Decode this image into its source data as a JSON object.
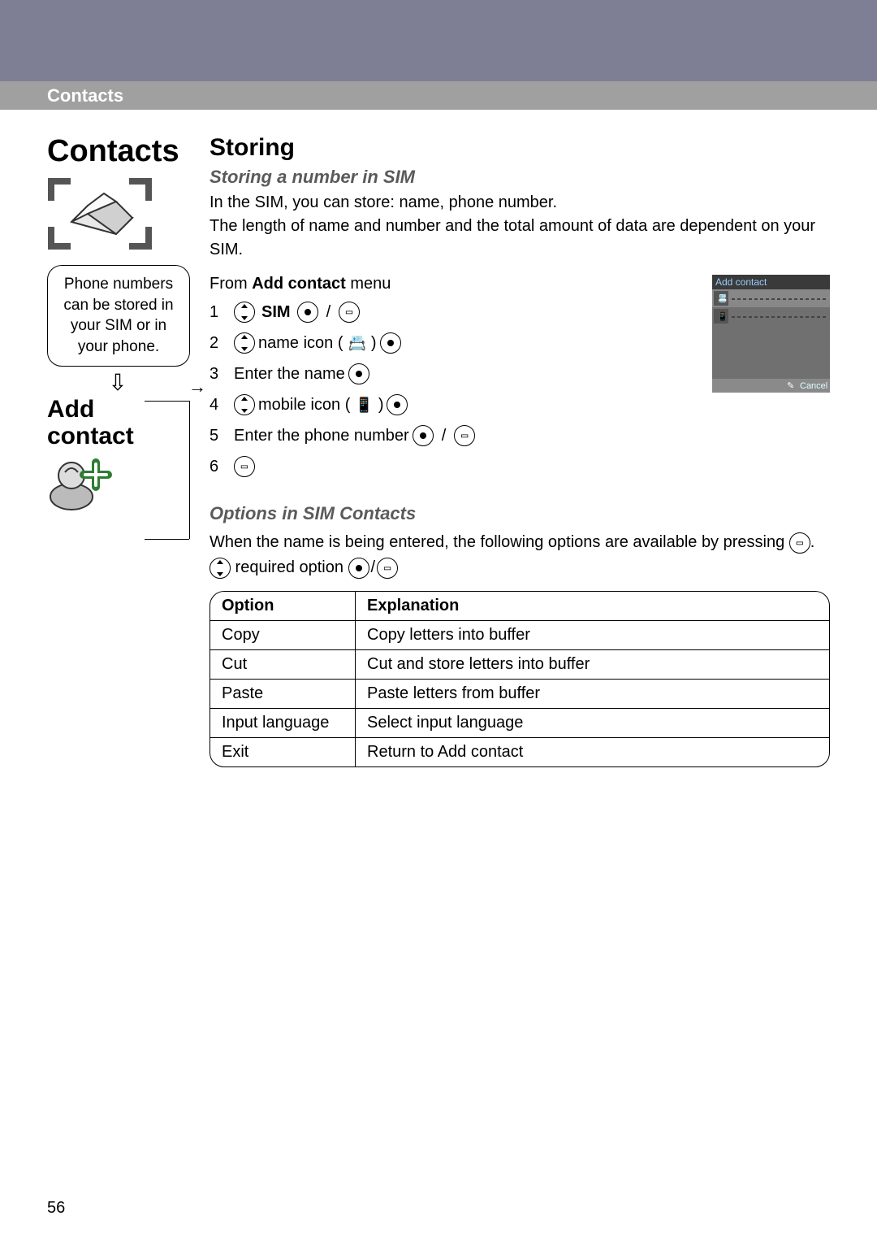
{
  "header": {
    "breadcrumb": "Contacts"
  },
  "left": {
    "title": "Contacts",
    "note": "Phone numbers can be stored in your SIM or in your phone.",
    "add_title_line1": "Add",
    "add_title_line2": "contact"
  },
  "main": {
    "h2": "Storing",
    "h3_sim": "Storing a number in SIM",
    "sim_p1": "In the SIM, you can store: name, phone number.",
    "sim_p2": "The length of name and number and the total amount of data are dependent on your SIM.",
    "from_prefix": "From ",
    "from_bold": "Add contact",
    "from_suffix": " menu",
    "steps": [
      {
        "n": "1",
        "parts": [
          "nav",
          " ",
          {
            "bold": "SIM"
          },
          " ",
          "dot",
          " ",
          "/",
          " ",
          "menu"
        ]
      },
      {
        "n": "2",
        "parts": [
          "nav",
          " name icon (",
          "name-glyph",
          ") ",
          "dot"
        ]
      },
      {
        "n": "3",
        "parts": [
          "Enter the name ",
          "dot"
        ]
      },
      {
        "n": "4",
        "parts": [
          "nav",
          " mobile icon ( ",
          "mobile-glyph",
          " ) ",
          "dot"
        ]
      },
      {
        "n": "5",
        "parts": [
          "Enter the phone number ",
          "dot",
          " ",
          "/",
          " ",
          "menu"
        ]
      },
      {
        "n": "6",
        "parts": [
          "menu"
        ]
      }
    ],
    "h3_options": "Options in SIM Contacts",
    "options_p_prefix": "When the name is being entered, the following options are available by pressing ",
    "options_p_suffix": ".",
    "options_line2_mid": " required option ",
    "table": {
      "headers": [
        "Option",
        "Explanation"
      ],
      "rows": [
        [
          "Copy",
          "Copy letters into buffer"
        ],
        [
          "Cut",
          "Cut and store letters into buffer"
        ],
        [
          "Paste",
          "Paste letters from buffer"
        ],
        [
          "Input language",
          "Select input language"
        ],
        [
          "Exit",
          "Return to Add contact"
        ]
      ]
    }
  },
  "phone_mock": {
    "title": "Add contact",
    "softkey_right": "Cancel"
  },
  "page_number": "56"
}
